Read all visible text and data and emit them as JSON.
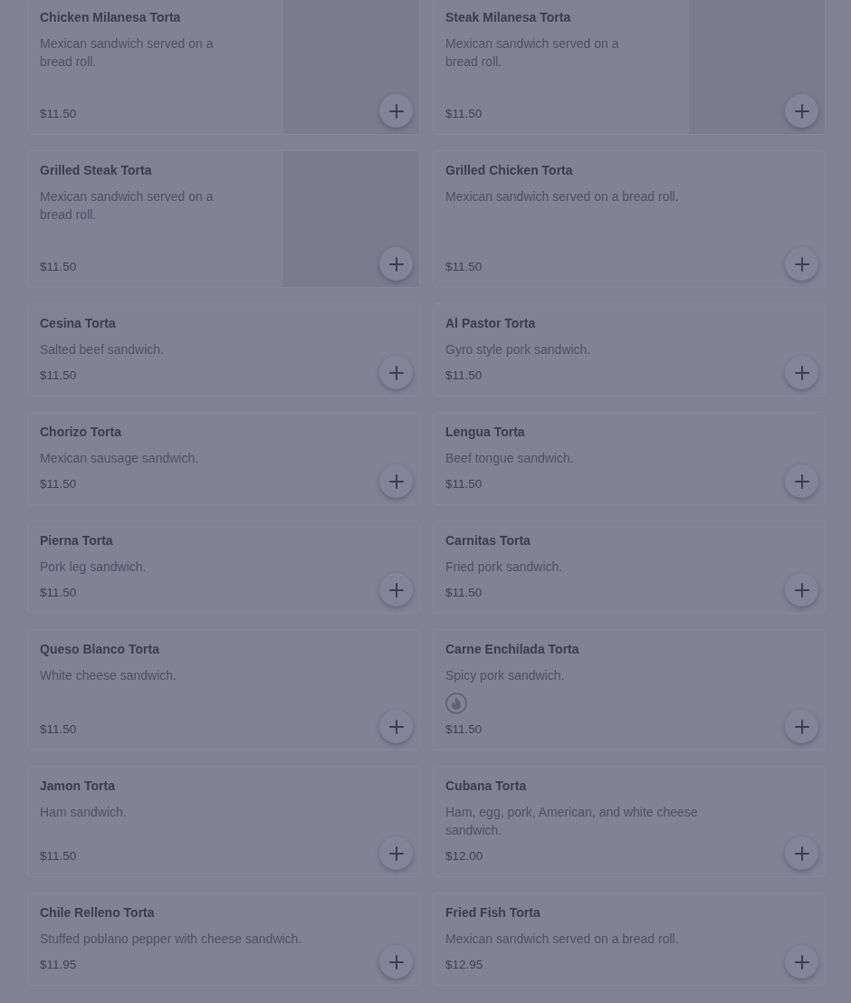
{
  "menu_items": [
    {
      "name": "Chicken Milanesa Torta",
      "description": "Mexican sandwich served on a bread roll.",
      "price": "$11.50",
      "image": true,
      "spicy": false
    },
    {
      "name": "Steak Milanesa Torta",
      "description": "Mexican sandwich served on a bread roll.",
      "price": "$11.50",
      "image": true,
      "spicy": false
    },
    {
      "name": "Grilled Steak Torta",
      "description": "Mexican sandwich served on a bread roll.",
      "price": "$11.50",
      "image": true,
      "spicy": false
    },
    {
      "name": "Grilled Chicken Torta",
      "description": "Mexican sandwich served on a bread roll.",
      "price": "$11.50",
      "image": false,
      "spicy": false
    },
    {
      "name": "Cesina Torta",
      "description": "Salted beef sandwich.",
      "price": "$11.50",
      "image": false,
      "spicy": false
    },
    {
      "name": "Al Pastor Torta",
      "description": "Gyro style pork sandwich.",
      "price": "$11.50",
      "image": false,
      "spicy": false
    },
    {
      "name": "Chorizo Torta",
      "description": "Mexican sausage sandwich.",
      "price": "$11.50",
      "image": false,
      "spicy": false
    },
    {
      "name": "Lengua Torta",
      "description": "Beef tongue sandwich.",
      "price": "$11.50",
      "image": false,
      "spicy": false
    },
    {
      "name": "Pierna Torta",
      "description": "Pork leg sandwich.",
      "price": "$11.50",
      "image": false,
      "spicy": false
    },
    {
      "name": "Carnitas Torta",
      "description": "Fried pork sandwich.",
      "price": "$11.50",
      "image": false,
      "spicy": false
    },
    {
      "name": "Queso Blanco Torta",
      "description": "White cheese sandwich.",
      "price": "$11.50",
      "image": false,
      "spicy": false
    },
    {
      "name": "Carne Enchilada Torta",
      "description": "Spicy pork sandwich.",
      "price": "$11.50",
      "image": false,
      "spicy": true
    },
    {
      "name": "Jamon Torta",
      "description": "Ham sandwich.",
      "price": "$11.50",
      "image": false,
      "spicy": false
    },
    {
      "name": "Cubana Torta",
      "description": "Ham, egg, pork, American, and white cheese sandwich.",
      "price": "$12.00",
      "image": false,
      "spicy": false
    },
    {
      "name": "Chile Relleno Torta",
      "description": "Stuffed poblano pepper with cheese sandwich.",
      "price": "$11.95",
      "image": false,
      "spicy": false
    },
    {
      "name": "Fried Fish Torta",
      "description": "Mexican sandwich served on a bread roll.",
      "price": "$12.95",
      "image": false,
      "spicy": false
    }
  ]
}
